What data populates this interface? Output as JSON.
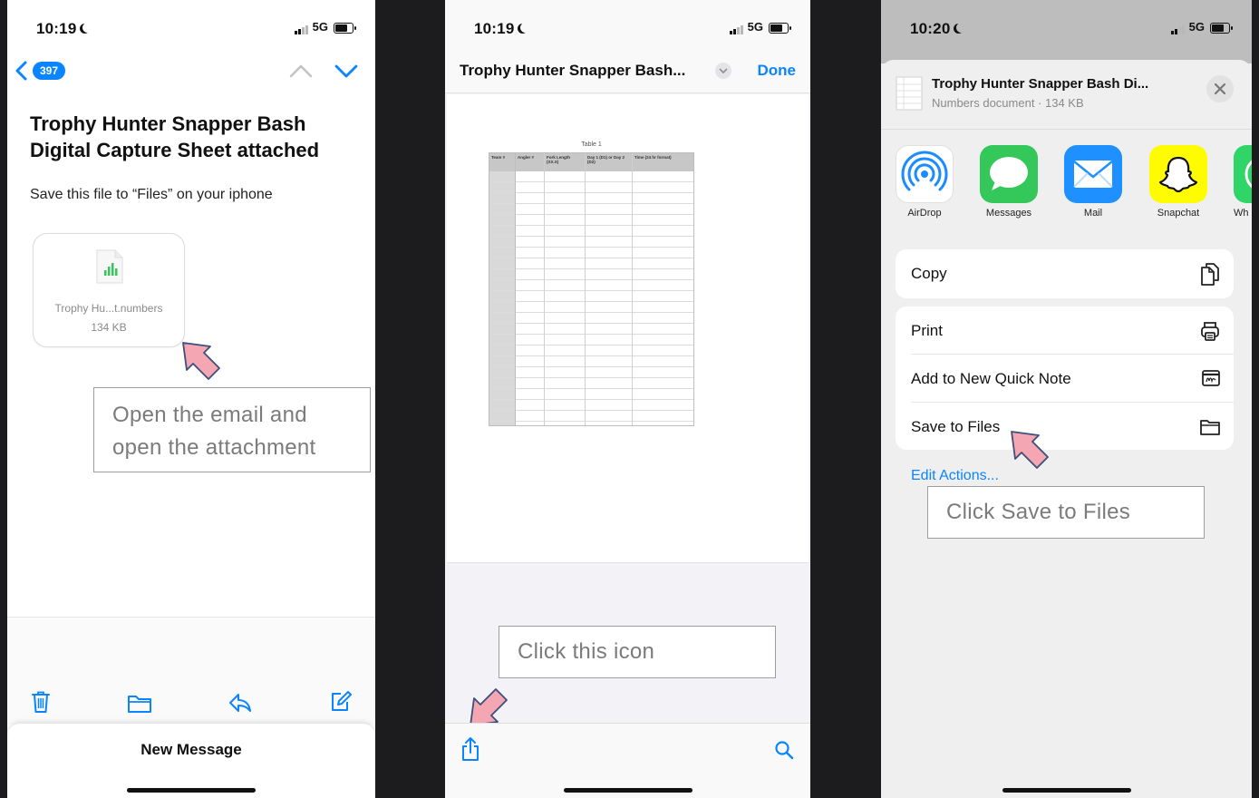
{
  "screen1": {
    "time": "10:19",
    "network": "5G",
    "back_badge": "397",
    "subject": "Trophy Hunter Snapper Bash Digital Capture Sheet attached",
    "body_text": "Save this file to “Files” on your iphone",
    "attachment": {
      "name": "Trophy Hu...t.numbers",
      "size": "134 KB"
    },
    "new_message_label": "New Message",
    "callout": "Open the email and open the attachment"
  },
  "screen2": {
    "time": "10:19",
    "network": "5G",
    "title": "Trophy Hunter Snapper Bash...",
    "done_label": "Done",
    "table_caption": "Table 1",
    "table_headers": [
      "Team #",
      "Angler #",
      "Fork Length (XX.X)",
      "Day 1 (D1) or Day 2 (D2)",
      "Time (24 hr format)"
    ],
    "callout": "Click this icon"
  },
  "screen3": {
    "time": "10:20",
    "network": "5G",
    "doc_title": "Trophy Hunter Snapper Bash Di...",
    "doc_subtitle": "Numbers document · 134 KB",
    "apps": [
      {
        "label": "AirDrop",
        "icon": "airdrop-icon"
      },
      {
        "label": "Messages",
        "icon": "messages-icon"
      },
      {
        "label": "Mail",
        "icon": "mail-icon"
      },
      {
        "label": "Snapchat",
        "icon": "snapchat-icon"
      },
      {
        "label": "Wh",
        "icon": "whatsapp-icon"
      }
    ],
    "actions": {
      "copy": "Copy",
      "print": "Print",
      "quick_note": "Add to New Quick Note",
      "save_files": "Save to Files"
    },
    "edit_actions": "Edit Actions...",
    "callout": "Click Save to Files"
  },
  "colors": {
    "ios_blue": "#0a84ff",
    "arrow_pink": "#f4a7b3",
    "arrow_stroke": "#3d4f7a"
  }
}
